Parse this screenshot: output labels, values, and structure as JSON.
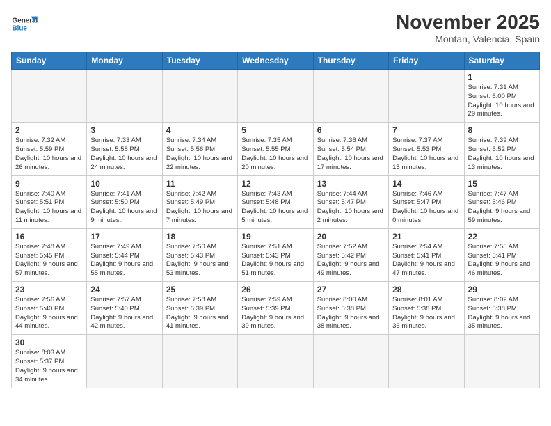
{
  "header": {
    "logo_general": "General",
    "logo_blue": "Blue",
    "month": "November 2025",
    "location": "Montan, Valencia, Spain"
  },
  "weekdays": [
    "Sunday",
    "Monday",
    "Tuesday",
    "Wednesday",
    "Thursday",
    "Friday",
    "Saturday"
  ],
  "days": [
    {
      "num": "",
      "empty": true
    },
    {
      "num": "",
      "empty": true
    },
    {
      "num": "",
      "empty": true
    },
    {
      "num": "",
      "empty": true
    },
    {
      "num": "",
      "empty": true
    },
    {
      "num": "",
      "empty": true
    },
    {
      "num": "1",
      "sunrise": "7:31 AM",
      "sunset": "6:00 PM",
      "daylight_hours": "10",
      "daylight_minutes": "29"
    },
    {
      "num": "2",
      "sunrise": "7:32 AM",
      "sunset": "5:59 PM",
      "daylight_hours": "10",
      "daylight_minutes": "26"
    },
    {
      "num": "3",
      "sunrise": "7:33 AM",
      "sunset": "5:58 PM",
      "daylight_hours": "10",
      "daylight_minutes": "24"
    },
    {
      "num": "4",
      "sunrise": "7:34 AM",
      "sunset": "5:56 PM",
      "daylight_hours": "10",
      "daylight_minutes": "22"
    },
    {
      "num": "5",
      "sunrise": "7:35 AM",
      "sunset": "5:55 PM",
      "daylight_hours": "10",
      "daylight_minutes": "20"
    },
    {
      "num": "6",
      "sunrise": "7:36 AM",
      "sunset": "5:54 PM",
      "daylight_hours": "10",
      "daylight_minutes": "17"
    },
    {
      "num": "7",
      "sunrise": "7:37 AM",
      "sunset": "5:53 PM",
      "daylight_hours": "10",
      "daylight_minutes": "15"
    },
    {
      "num": "8",
      "sunrise": "7:39 AM",
      "sunset": "5:52 PM",
      "daylight_hours": "10",
      "daylight_minutes": "13"
    },
    {
      "num": "9",
      "sunrise": "7:40 AM",
      "sunset": "5:51 PM",
      "daylight_hours": "10",
      "daylight_minutes": "11"
    },
    {
      "num": "10",
      "sunrise": "7:41 AM",
      "sunset": "5:50 PM",
      "daylight_hours": "10",
      "daylight_minutes": "9"
    },
    {
      "num": "11",
      "sunrise": "7:42 AM",
      "sunset": "5:49 PM",
      "daylight_hours": "10",
      "daylight_minutes": "7"
    },
    {
      "num": "12",
      "sunrise": "7:43 AM",
      "sunset": "5:48 PM",
      "daylight_hours": "10",
      "daylight_minutes": "5"
    },
    {
      "num": "13",
      "sunrise": "7:44 AM",
      "sunset": "5:47 PM",
      "daylight_hours": "10",
      "daylight_minutes": "2"
    },
    {
      "num": "14",
      "sunrise": "7:46 AM",
      "sunset": "5:47 PM",
      "daylight_hours": "10",
      "daylight_minutes": "0"
    },
    {
      "num": "15",
      "sunrise": "7:47 AM",
      "sunset": "5:46 PM",
      "daylight_hours": "9",
      "daylight_minutes": "59"
    },
    {
      "num": "16",
      "sunrise": "7:48 AM",
      "sunset": "5:45 PM",
      "daylight_hours": "9",
      "daylight_minutes": "57"
    },
    {
      "num": "17",
      "sunrise": "7:49 AM",
      "sunset": "5:44 PM",
      "daylight_hours": "9",
      "daylight_minutes": "55"
    },
    {
      "num": "18",
      "sunrise": "7:50 AM",
      "sunset": "5:43 PM",
      "daylight_hours": "9",
      "daylight_minutes": "53"
    },
    {
      "num": "19",
      "sunrise": "7:51 AM",
      "sunset": "5:43 PM",
      "daylight_hours": "9",
      "daylight_minutes": "51"
    },
    {
      "num": "20",
      "sunrise": "7:52 AM",
      "sunset": "5:42 PM",
      "daylight_hours": "9",
      "daylight_minutes": "49"
    },
    {
      "num": "21",
      "sunrise": "7:54 AM",
      "sunset": "5:41 PM",
      "daylight_hours": "9",
      "daylight_minutes": "47"
    },
    {
      "num": "22",
      "sunrise": "7:55 AM",
      "sunset": "5:41 PM",
      "daylight_hours": "9",
      "daylight_minutes": "46"
    },
    {
      "num": "23",
      "sunrise": "7:56 AM",
      "sunset": "5:40 PM",
      "daylight_hours": "9",
      "daylight_minutes": "44"
    },
    {
      "num": "24",
      "sunrise": "7:57 AM",
      "sunset": "5:40 PM",
      "daylight_hours": "9",
      "daylight_minutes": "42"
    },
    {
      "num": "25",
      "sunrise": "7:58 AM",
      "sunset": "5:39 PM",
      "daylight_hours": "9",
      "daylight_minutes": "41"
    },
    {
      "num": "26",
      "sunrise": "7:59 AM",
      "sunset": "5:39 PM",
      "daylight_hours": "9",
      "daylight_minutes": "39"
    },
    {
      "num": "27",
      "sunrise": "8:00 AM",
      "sunset": "5:38 PM",
      "daylight_hours": "9",
      "daylight_minutes": "38"
    },
    {
      "num": "28",
      "sunrise": "8:01 AM",
      "sunset": "5:38 PM",
      "daylight_hours": "9",
      "daylight_minutes": "36"
    },
    {
      "num": "29",
      "sunrise": "8:02 AM",
      "sunset": "5:38 PM",
      "daylight_hours": "9",
      "daylight_minutes": "35"
    },
    {
      "num": "30",
      "sunrise": "8:03 AM",
      "sunset": "5:37 PM",
      "daylight_hours": "9",
      "daylight_minutes": "34"
    },
    {
      "num": "",
      "empty": true
    },
    {
      "num": "",
      "empty": true
    },
    {
      "num": "",
      "empty": true
    },
    {
      "num": "",
      "empty": true
    },
    {
      "num": "",
      "empty": true
    },
    {
      "num": "",
      "empty": true
    }
  ]
}
